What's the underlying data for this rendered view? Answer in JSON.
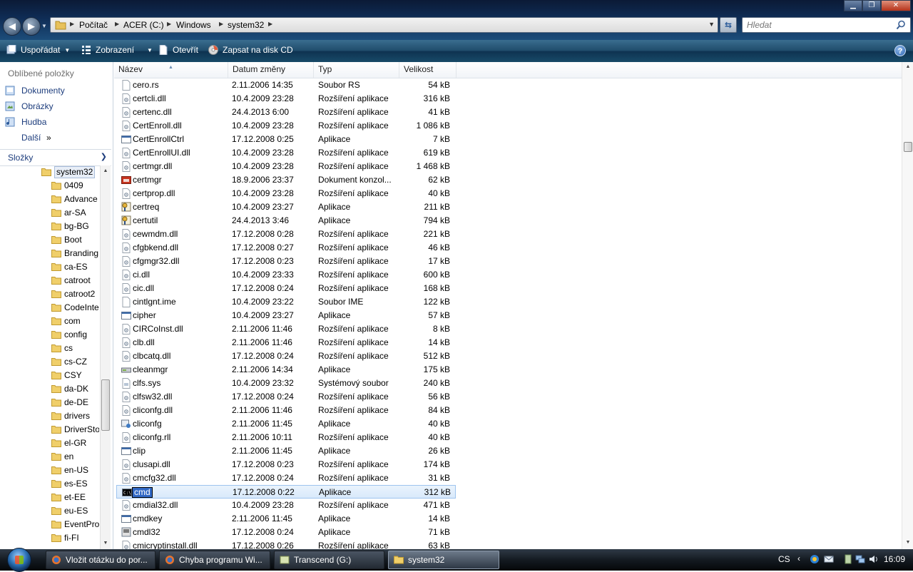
{
  "window": {
    "controls": {
      "minimize": "▁",
      "maximize": "❐",
      "close": "✕"
    }
  },
  "address": {
    "crumbs": [
      "Počítač",
      "ACER (C:)",
      "Windows",
      "system32"
    ]
  },
  "search": {
    "placeholder": "Hledat"
  },
  "toolbar": {
    "organize": "Uspořádat",
    "views": "Zobrazení",
    "open": "Otevřít",
    "burn": "Zapsat na disk CD"
  },
  "nav": {
    "favorites_title": "Oblíbené položky",
    "favorites": [
      "Dokumenty",
      "Obrázky",
      "Hudba"
    ],
    "more": "Další",
    "more_glyph": "»",
    "folders_title": "Složky",
    "tree_root": "system32",
    "tree": [
      "0409",
      "Advance",
      "ar-SA",
      "bg-BG",
      "Boot",
      "Branding",
      "ca-ES",
      "catroot",
      "catroot2",
      "CodeInte",
      "com",
      "config",
      "cs",
      "cs-CZ",
      "CSY",
      "da-DK",
      "de-DE",
      "drivers",
      "DriverSto",
      "el-GR",
      "en",
      "en-US",
      "es-ES",
      "et-EE",
      "eu-ES",
      "EventPro",
      "fi-FI"
    ]
  },
  "columns": {
    "name": "Název",
    "date": "Datum změny",
    "type": "Typ",
    "size": "Velikost"
  },
  "files": [
    {
      "name": "cero.rs",
      "date": "2.11.2006 14:35",
      "type": "Soubor RS",
      "size": "54 kB",
      "icon": "blank-file"
    },
    {
      "name": "certcli.dll",
      "date": "10.4.2009 23:28",
      "type": "Rozšíření aplikace",
      "size": "316 kB",
      "icon": "dll-file"
    },
    {
      "name": "certenc.dll",
      "date": "24.4.2013 6:00",
      "type": "Rozšíření aplikace",
      "size": "41 kB",
      "icon": "dll-file"
    },
    {
      "name": "CertEnroll.dll",
      "date": "10.4.2009 23:28",
      "type": "Rozšíření aplikace",
      "size": "1 086 kB",
      "icon": "dll-file"
    },
    {
      "name": "CertEnrollCtrl",
      "date": "17.12.2008 0:25",
      "type": "Aplikace",
      "size": "7 kB",
      "icon": "exe-file"
    },
    {
      "name": "CertEnrollUI.dll",
      "date": "10.4.2009 23:28",
      "type": "Rozšíření aplikace",
      "size": "619 kB",
      "icon": "dll-file"
    },
    {
      "name": "certmgr.dll",
      "date": "10.4.2009 23:28",
      "type": "Rozšíření aplikace",
      "size": "1 468 kB",
      "icon": "dll-file"
    },
    {
      "name": "certmgr",
      "date": "18.9.2006 23:37",
      "type": "Dokument konzol...",
      "size": "62 kB",
      "icon": "msc-file"
    },
    {
      "name": "certprop.dll",
      "date": "10.4.2009 23:28",
      "type": "Rozšíření aplikace",
      "size": "40 kB",
      "icon": "dll-file"
    },
    {
      "name": "certreq",
      "date": "10.4.2009 23:27",
      "type": "Aplikace",
      "size": "211 kB",
      "icon": "cert-exe"
    },
    {
      "name": "certutil",
      "date": "24.4.2013 3:46",
      "type": "Aplikace",
      "size": "794 kB",
      "icon": "cert-exe"
    },
    {
      "name": "cewmdm.dll",
      "date": "17.12.2008 0:28",
      "type": "Rozšíření aplikace",
      "size": "221 kB",
      "icon": "dll-file"
    },
    {
      "name": "cfgbkend.dll",
      "date": "17.12.2008 0:27",
      "type": "Rozšíření aplikace",
      "size": "46 kB",
      "icon": "dll-file"
    },
    {
      "name": "cfgmgr32.dll",
      "date": "17.12.2008 0:23",
      "type": "Rozšíření aplikace",
      "size": "17 kB",
      "icon": "dll-file"
    },
    {
      "name": "ci.dll",
      "date": "10.4.2009 23:33",
      "type": "Rozšíření aplikace",
      "size": "600 kB",
      "icon": "dll-file"
    },
    {
      "name": "cic.dll",
      "date": "17.12.2008 0:24",
      "type": "Rozšíření aplikace",
      "size": "168 kB",
      "icon": "dll-file"
    },
    {
      "name": "cintlgnt.ime",
      "date": "10.4.2009 23:22",
      "type": "Soubor IME",
      "size": "122 kB",
      "icon": "blank-file"
    },
    {
      "name": "cipher",
      "date": "10.4.2009 23:27",
      "type": "Aplikace",
      "size": "57 kB",
      "icon": "exe-file"
    },
    {
      "name": "CIRCoInst.dll",
      "date": "2.11.2006 11:46",
      "type": "Rozšíření aplikace",
      "size": "8 kB",
      "icon": "dll-file"
    },
    {
      "name": "clb.dll",
      "date": "2.11.2006 11:46",
      "type": "Rozšíření aplikace",
      "size": "14 kB",
      "icon": "dll-file"
    },
    {
      "name": "clbcatq.dll",
      "date": "17.12.2008 0:24",
      "type": "Rozšíření aplikace",
      "size": "512 kB",
      "icon": "dll-file"
    },
    {
      "name": "cleanmgr",
      "date": "2.11.2006 14:34",
      "type": "Aplikace",
      "size": "175 kB",
      "icon": "drive-exe"
    },
    {
      "name": "clfs.sys",
      "date": "10.4.2009 23:32",
      "type": "Systémový soubor",
      "size": "240 kB",
      "icon": "sys-file"
    },
    {
      "name": "clfsw32.dll",
      "date": "17.12.2008 0:24",
      "type": "Rozšíření aplikace",
      "size": "56 kB",
      "icon": "dll-file"
    },
    {
      "name": "cliconfg.dll",
      "date": "2.11.2006 11:46",
      "type": "Rozšíření aplikace",
      "size": "84 kB",
      "icon": "dll-file"
    },
    {
      "name": "cliconfg",
      "date": "2.11.2006 11:45",
      "type": "Aplikace",
      "size": "40 kB",
      "icon": "config-exe"
    },
    {
      "name": "cliconfg.rll",
      "date": "2.11.2006 10:11",
      "type": "Rozšíření aplikace",
      "size": "40 kB",
      "icon": "dll-file"
    },
    {
      "name": "clip",
      "date": "2.11.2006 11:45",
      "type": "Aplikace",
      "size": "26 kB",
      "icon": "exe-file"
    },
    {
      "name": "clusapi.dll",
      "date": "17.12.2008 0:23",
      "type": "Rozšíření aplikace",
      "size": "174 kB",
      "icon": "dll-file"
    },
    {
      "name": "cmcfg32.dll",
      "date": "17.12.2008 0:24",
      "type": "Rozšíření aplikace",
      "size": "31 kB",
      "icon": "dll-file"
    },
    {
      "name": "cmd",
      "date": "17.12.2008 0:22",
      "type": "Aplikace",
      "size": "312 kB",
      "icon": "console-exe",
      "selected": true
    },
    {
      "name": "cmdial32.dll",
      "date": "10.4.2009 23:28",
      "type": "Rozšíření aplikace",
      "size": "471 kB",
      "icon": "dll-file"
    },
    {
      "name": "cmdkey",
      "date": "2.11.2006 11:45",
      "type": "Aplikace",
      "size": "14 kB",
      "icon": "exe-file"
    },
    {
      "name": "cmdl32",
      "date": "17.12.2008 0:24",
      "type": "Aplikace",
      "size": "71 kB",
      "icon": "phone-exe"
    },
    {
      "name": "cmicryptinstall.dll",
      "date": "17.12.2008 0:26",
      "type": "Rozšíření aplikace",
      "size": "63 kB",
      "icon": "dll-file"
    }
  ],
  "taskbar": {
    "tasks": [
      {
        "label": "Vložit otázku do por...",
        "icon": "firefox-icon"
      },
      {
        "label": "Chyba programu Wi...",
        "icon": "firefox-icon"
      },
      {
        "label": "Transcend (G:)",
        "icon": "drive-icon"
      },
      {
        "label": "system32",
        "icon": "folder-icon",
        "active": true
      }
    ],
    "lang": "CS",
    "tray_chevron": "‹",
    "clock": "16:09"
  },
  "colors": {
    "accent": "#1c3c7c",
    "selection": "#3169c6",
    "cmdbar": "#1f4b6a"
  }
}
